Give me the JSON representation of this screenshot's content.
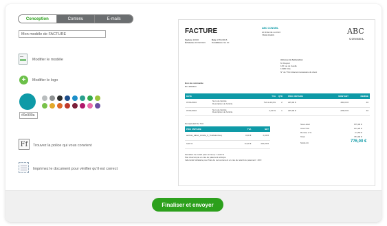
{
  "tabs": [
    {
      "label": "Conception",
      "active": true
    },
    {
      "label": "Contenu",
      "active": false
    },
    {
      "label": "E-mails",
      "active": false
    }
  ],
  "template_name": "Mon modèle de FACTURE",
  "options": {
    "modify_template": "Modifier le modèle",
    "modify_logo": "Modifier le logo",
    "font_tip": "Trouvez la police qui vous convient",
    "print_tip": "Imprimez le document pour vérifier qu'il est correct"
  },
  "color": {
    "selected_hex": "#0e9aa7",
    "hex_value": "#0e909a",
    "palette": [
      "#b9bdbe",
      "#8e9192",
      "#2d2d2d",
      "#1d4d8a",
      "#1c8fc9",
      "#2a9f8e",
      "#35a94d",
      "#9cc43b",
      "#79c24a",
      "#e3a92b",
      "#de6a2a",
      "#c0392b",
      "#7b1f3a",
      "#b0176b",
      "#e86ba8",
      "#6b4fa3"
    ]
  },
  "footer": {
    "primary_button": "Finaliser et envoyer"
  },
  "invoice": {
    "title": "FACTURE",
    "meta": {
      "facture_label": "Facture",
      "facture_value": "10046",
      "echeance_label": "Échéance",
      "echeance_value": "16/02/2016",
      "date_label": "Date",
      "date_value": "17/01/2016",
      "conditions_label": "Conditions",
      "conditions_value": "Net 30"
    },
    "company_name": "ABC CONSEIL",
    "company_address_1": "20 RUE DE LA PAIX",
    "company_address_2": "75002 PARIS",
    "logo_main": "ABC",
    "logo_sub": "CONSEIL",
    "billing": {
      "label": "Adresse de facturation",
      "name": "M. Dupont",
      "street": "125 rue de Gaulle",
      "city": "13380 Ville",
      "vat": "N° de TVA intracommunautaire du client"
    },
    "order": {
      "label": "Bon de commande",
      "value": "BC 4865493"
    },
    "columns": [
      "DATE",
      "",
      "TVA",
      "QTÉ",
      "PRIX UNITAIRE",
      "MONTANT",
      "REMISE"
    ],
    "rows": [
      {
        "date": "07/01/2016",
        "desc_1": "Nom de l'article",
        "desc_2": "Description de l'article",
        "tva": "TVA à 20,0%",
        "qty": "2",
        "unit": "225,00 €",
        "amount": "450,00 €",
        "discount": "40"
      },
      {
        "date": "07/01/2016",
        "desc_1": "Nom de l'article",
        "desc_2": "Description de l'article",
        "tva": "0,00 %",
        "qty": "1",
        "unit": "225,00 €",
        "amount": "225,00 €",
        "discount": "40"
      }
    ],
    "vat_recap": {
      "label": "Récapitulatif de TVA",
      "columns": [
        "PRIX UNITAIRE",
        "TVA",
        "NET"
      ],
      "rows": [
        {
          "unit": "activité_tabac_intitulé_0_Toutfaireinteq",
          "tva": "0,00 €",
          "net": "0,00 €"
        },
        {
          "unit": "0,00 %",
          "tva": "11,00 €",
          "net": "220,00 €"
        }
      ]
    },
    "totals": [
      {
        "label": "Sous-total",
        "value": "675,00 €"
      },
      {
        "label": "Total TVA",
        "value": "101,25 €"
      },
      {
        "label": "Remise 2 %",
        "value": "- 13,50 €"
      },
      {
        "label": "Total",
        "value": "763,00 €"
      }
    ],
    "balance": {
      "label": "Solde dû",
      "value": "776,00 €"
    },
    "notes": [
      "Pénalités de retard (taux annuel) : 10,00 %",
      "Pas d'escompte en cas de paiement anticipé",
      "Indemnité forfaitaire pour frais de recouvrement en cas de retard de paiement : 40 €"
    ]
  }
}
